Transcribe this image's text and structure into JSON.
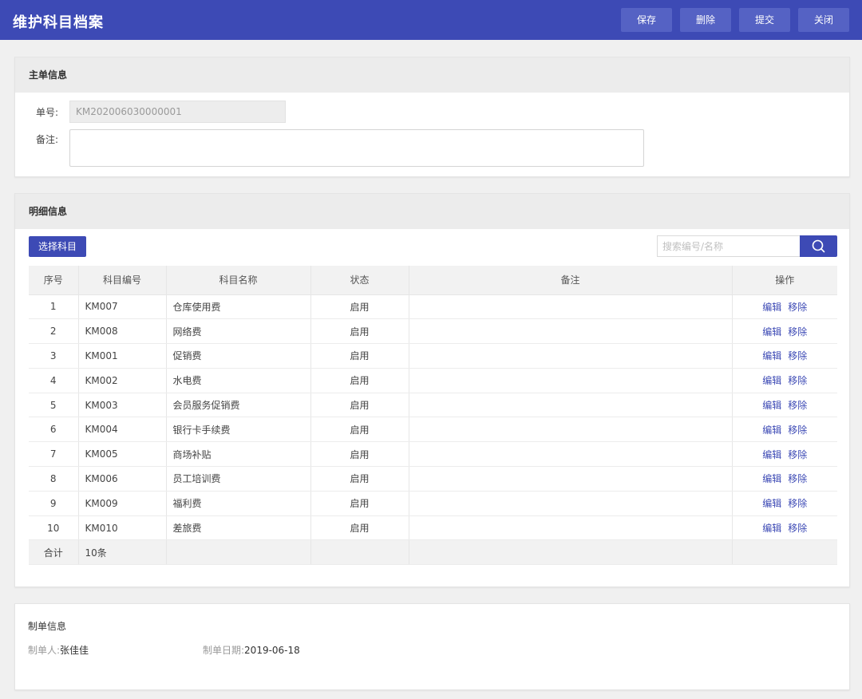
{
  "header": {
    "title": "维护科目档案",
    "buttons": {
      "save": "保存",
      "delete": "删除",
      "submit": "提交",
      "close": "关闭"
    }
  },
  "main_info": {
    "section_title": "主单信息",
    "order_no_label": "单号:",
    "order_no_value": "KM202006030000001",
    "remark_label": "备注:",
    "remark_value": ""
  },
  "detail": {
    "section_title": "明细信息",
    "select_button": "选择科目",
    "search_placeholder": "搜索编号/名称",
    "columns": [
      "序号",
      "科目编号",
      "科目名称",
      "状态",
      "备注",
      "操作"
    ],
    "edit_label": "编辑",
    "remove_label": "移除",
    "rows": [
      {
        "no": "1",
        "code": "KM007",
        "name": "仓库使用费",
        "status": "启用",
        "remark": ""
      },
      {
        "no": "2",
        "code": "KM008",
        "name": "网络费",
        "status": "启用",
        "remark": ""
      },
      {
        "no": "3",
        "code": "KM001",
        "name": "促销费",
        "status": "启用",
        "remark": ""
      },
      {
        "no": "4",
        "code": "KM002",
        "name": "水电费",
        "status": "启用",
        "remark": ""
      },
      {
        "no": "5",
        "code": "KM003",
        "name": "会员服务促销费",
        "status": "启用",
        "remark": ""
      },
      {
        "no": "6",
        "code": "KM004",
        "name": "银行卡手续费",
        "status": "启用",
        "remark": ""
      },
      {
        "no": "7",
        "code": "KM005",
        "name": "商场补贴",
        "status": "启用",
        "remark": ""
      },
      {
        "no": "8",
        "code": "KM006",
        "name": "员工培训费",
        "status": "启用",
        "remark": ""
      },
      {
        "no": "9",
        "code": "KM009",
        "name": "福利费",
        "status": "启用",
        "remark": ""
      },
      {
        "no": "10",
        "code": "KM010",
        "name": "差旅费",
        "status": "启用",
        "remark": ""
      }
    ],
    "total_label": "合计",
    "total_count": "10条"
  },
  "creator_info": {
    "section_title": "制单信息",
    "creator_label": "制单人:",
    "creator_value": "张佳佳",
    "date_label": "制单日期:",
    "date_value": "2019-06-18"
  },
  "colors": {
    "primary": "#3d4ab5",
    "header_button": "#5562c4",
    "section_bg": "#ececec"
  },
  "icons": {
    "search": "search-icon"
  }
}
